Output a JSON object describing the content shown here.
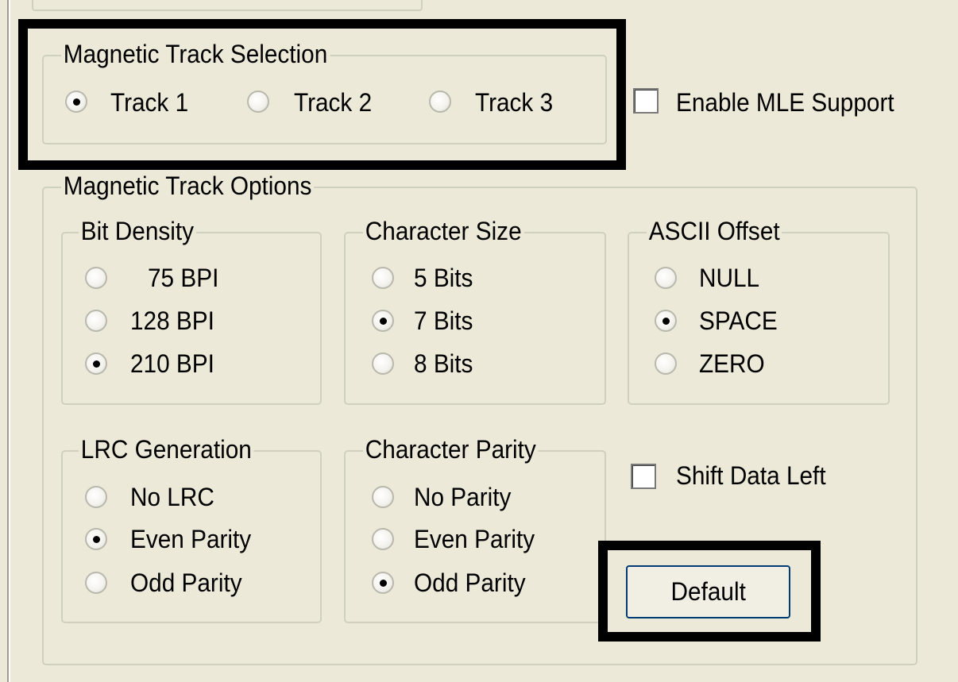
{
  "track_selection": {
    "legend": "Magnetic Track Selection",
    "options": [
      {
        "label": "Track 1",
        "selected": true
      },
      {
        "label": "Track 2",
        "selected": false
      },
      {
        "label": "Track 3",
        "selected": false
      }
    ]
  },
  "mle_support": {
    "label": "Enable MLE Support",
    "checked": false
  },
  "track_options": {
    "legend": "Magnetic Track Options",
    "bit_density": {
      "legend": "Bit Density",
      "options": [
        {
          "label": "75 BPI",
          "selected": false
        },
        {
          "label": "128 BPI",
          "selected": false
        },
        {
          "label": "210 BPI",
          "selected": true
        }
      ]
    },
    "character_size": {
      "legend": "Character Size",
      "options": [
        {
          "label": "5 Bits",
          "selected": false
        },
        {
          "label": "7 Bits",
          "selected": true
        },
        {
          "label": "8 Bits",
          "selected": false
        }
      ]
    },
    "ascii_offset": {
      "legend": "ASCII Offset",
      "options": [
        {
          "label": "NULL",
          "selected": false
        },
        {
          "label": "SPACE",
          "selected": true
        },
        {
          "label": "ZERO",
          "selected": false
        }
      ]
    },
    "lrc_generation": {
      "legend": "LRC Generation",
      "options": [
        {
          "label": "No LRC",
          "selected": false
        },
        {
          "label": "Even Parity",
          "selected": true
        },
        {
          "label": "Odd Parity",
          "selected": false
        }
      ]
    },
    "character_parity": {
      "legend": "Character Parity",
      "options": [
        {
          "label": "No Parity",
          "selected": false
        },
        {
          "label": "Even Parity",
          "selected": false
        },
        {
          "label": "Odd Parity",
          "selected": true
        }
      ]
    },
    "shift_data_left": {
      "label": "Shift Data Left",
      "checked": false
    },
    "default_button": {
      "label": "Default"
    }
  }
}
